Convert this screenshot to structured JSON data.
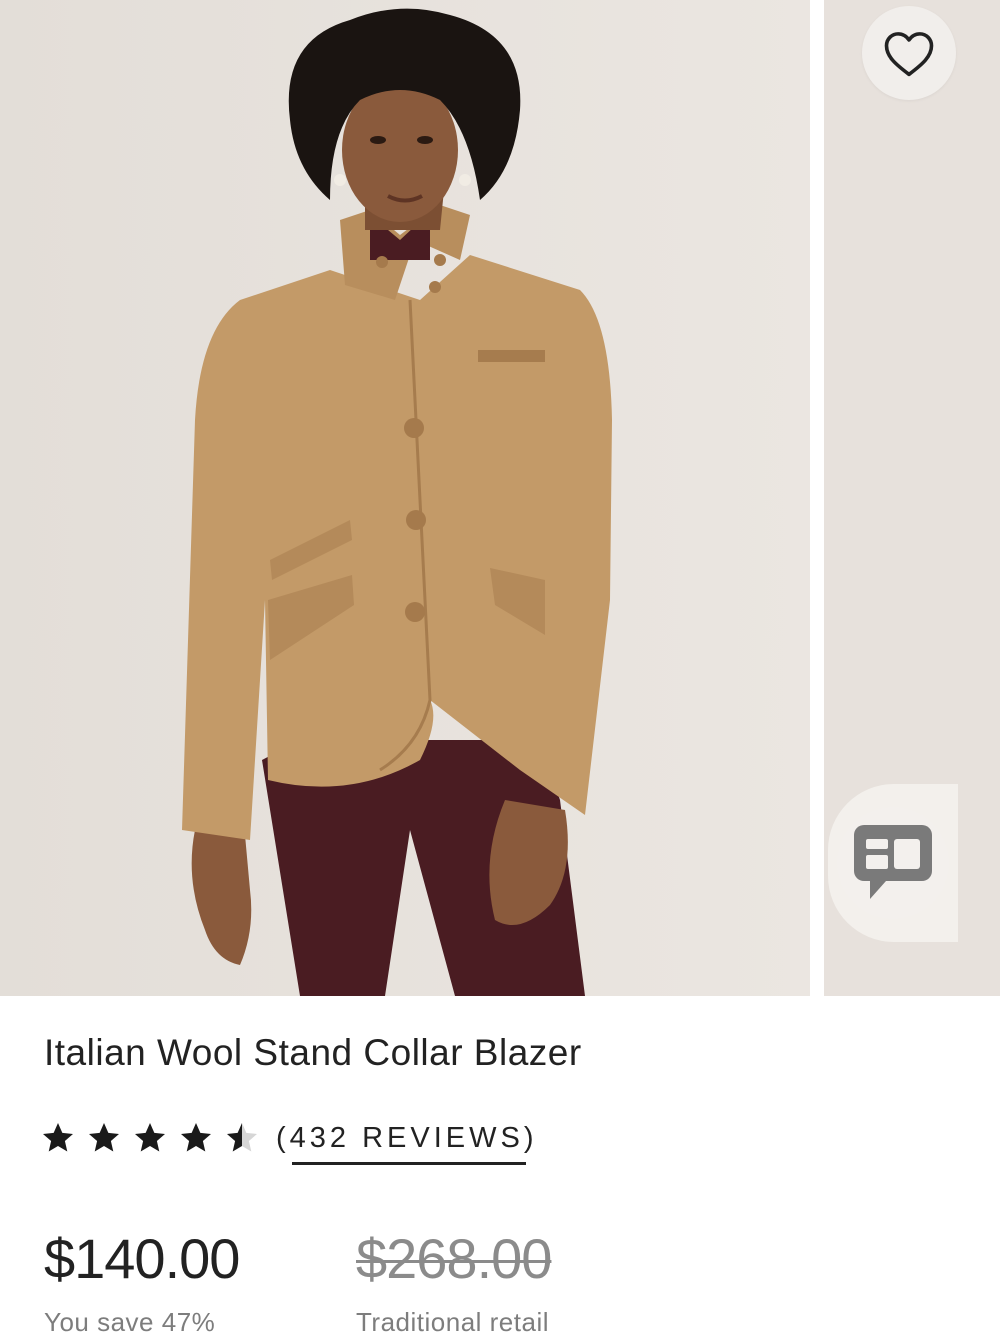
{
  "product": {
    "title": "Italian Wool Stand Collar Blazer",
    "rating": 4.5,
    "rating_max": 5,
    "reviews_label": "(432 REVIEWS)",
    "price": "$140.00",
    "savings": "You save 47%",
    "retail_price": "$268.00",
    "retail_label": "Traditional retail"
  },
  "gallery": {
    "main_image": "model-wearing-camel-blazer-photo",
    "next_image": "next-product-photo-preview"
  },
  "icons": {
    "favorite": "heart-outline-icon",
    "chat": "chat-bubble-icon",
    "star": "star-icon"
  },
  "colors": {
    "blazer": "#c39a68",
    "trousers": "#4a1c22",
    "photo_background": "#e9e4df",
    "text": "#222222",
    "muted_text": "#7d7d7d"
  }
}
